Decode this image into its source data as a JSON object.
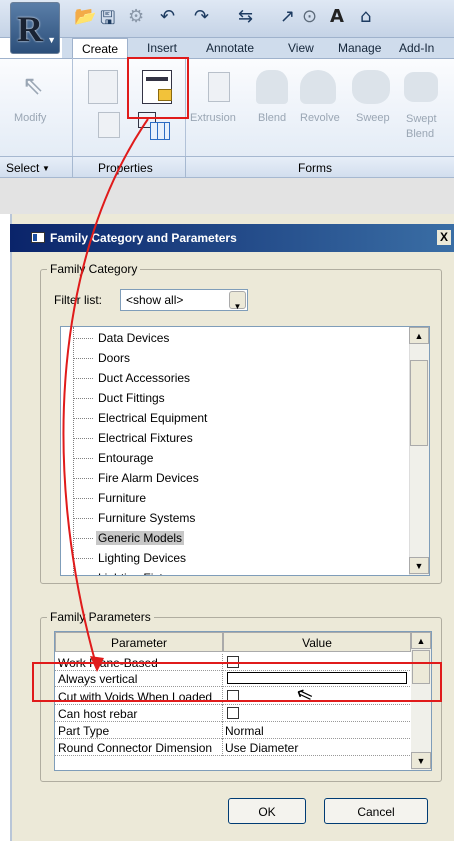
{
  "ribbon": {
    "tabs": [
      "Create",
      "Insert",
      "Annotate",
      "View",
      "Manage",
      "Add-In"
    ],
    "tools": [
      "Modify",
      "Extrusion",
      "Blend",
      "Revolve",
      "Sweep",
      "Swept Blend"
    ],
    "panels": {
      "select": "Select",
      "properties": "Properties",
      "forms": "Forms"
    }
  },
  "dialog": {
    "title": "Family Category and Parameters",
    "close": "X",
    "category_group": "Family Category",
    "filter_label": "Filter list:",
    "filter_value": "<show all>",
    "categories": [
      "Data Devices",
      "Doors",
      "Duct Accessories",
      "Duct Fittings",
      "Electrical Equipment",
      "Electrical Fixtures",
      "Entourage",
      "Fire Alarm Devices",
      "Furniture",
      "Furniture Systems",
      "Generic Models",
      "Lighting Devices",
      "Lighting Fixtures"
    ],
    "selected_category": "Generic Models",
    "params_group": "Family Parameters",
    "columns": [
      "Parameter",
      "Value"
    ],
    "parameters": [
      {
        "name": "Work Plane-Based",
        "value": "",
        "checkbox": true,
        "checked": false
      },
      {
        "name": "Always vertical",
        "value": "",
        "checkbox": true,
        "checked": false
      },
      {
        "name": "Cut with Voids When Loaded",
        "value": "",
        "checkbox": true,
        "checked": false
      },
      {
        "name": "Can host rebar",
        "value": "",
        "checkbox": true,
        "checked": false
      },
      {
        "name": "Part Type",
        "value": "Normal",
        "checkbox": false
      },
      {
        "name": "Round Connector Dimension",
        "value": "Use Diameter",
        "checkbox": false
      }
    ],
    "ok": "OK",
    "cancel": "Cancel"
  },
  "annotation_color": "#e01b1b"
}
